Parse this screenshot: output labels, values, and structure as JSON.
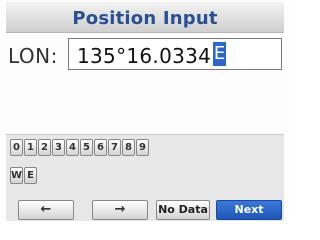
{
  "header": {
    "title": "Position Input"
  },
  "field": {
    "label": "LON:",
    "value": "135°16.0334",
    "cursor_char": "E"
  },
  "keyboard": {
    "digits": [
      "0",
      "1",
      "2",
      "3",
      "4",
      "5",
      "6",
      "7",
      "8",
      "9"
    ],
    "direction_keys": [
      "W",
      "E"
    ],
    "left_arrow": "←",
    "right_arrow": "→",
    "no_data": "No Data",
    "next": "Next"
  },
  "colors": {
    "accent": "#2f66c9",
    "title": "#2a4f93"
  }
}
